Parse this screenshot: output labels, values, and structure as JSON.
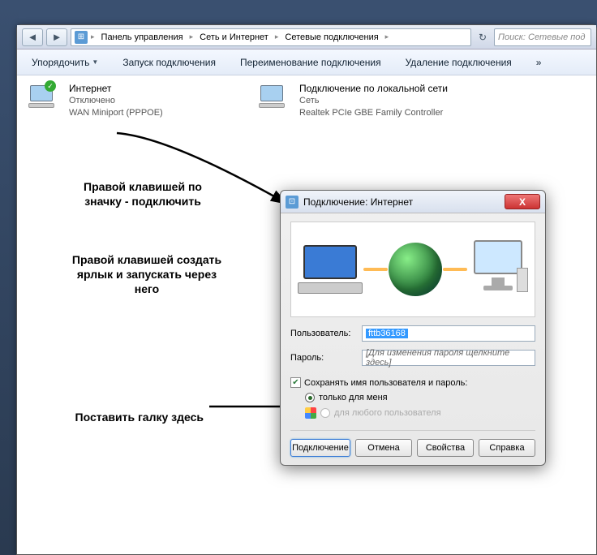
{
  "breadcrumb": {
    "items": [
      "Панель управления",
      "Сеть и Интернет",
      "Сетевые подключения"
    ]
  },
  "search": {
    "placeholder": "Поиск: Сетевые под"
  },
  "toolbar": {
    "organize": "Упорядочить",
    "start": "Запуск подключения",
    "rename": "Переименование подключения",
    "delete": "Удаление подключения",
    "more": "»"
  },
  "connections": [
    {
      "title": "Интернет",
      "status": "Отключено",
      "device": "WAN Miniport (PPPOE)"
    },
    {
      "title": "Подключение по локальной сети",
      "status": "Сеть",
      "device": "Realtek PCIe GBE Family Controller"
    }
  ],
  "annotations": {
    "a1": "Правой клавишей по значку - подключить",
    "a2": "Правой клавишей создать ярлык и запускать через него",
    "a3": "Поставить галку здесь"
  },
  "dialog": {
    "title": "Подключение: Интернет",
    "user_label": "Пользователь:",
    "user_value": "fttb36168",
    "pass_label": "Пароль:",
    "pass_placeholder": "[Для изменения пароля щелкните здесь]",
    "save_label": "Сохранять имя пользователя и пароль:",
    "radio_me": "только для меня",
    "radio_all": "для любого пользователя",
    "btn_connect": "Подключение",
    "btn_cancel": "Отмена",
    "btn_props": "Свойства",
    "btn_help": "Справка"
  }
}
